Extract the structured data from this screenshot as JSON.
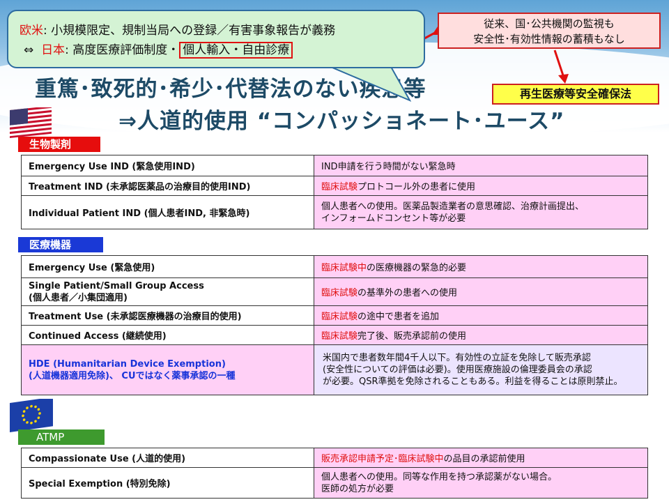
{
  "callout": {
    "line1_prefix": "欧米",
    "line1_text": ": 小規模限定、規制当局への登録／有害事象報告が義務",
    "line2_arrow": "⇔",
    "line2_prefix": "日本",
    "line2_text": ": 高度医療評価制度・",
    "line2_highlight": "個人輸入・自由診療"
  },
  "note": {
    "line1": "従来、国･公共機関の監視も",
    "line2": "安全性･有効性情報の蓄積もなし"
  },
  "law_box": "再生医療等安全確保法",
  "title": {
    "line1": "重篤･致死的･希少･代替法のない疾患等",
    "line2": "⇒人道的使用 “コンパッショネート･ユース”"
  },
  "sections": {
    "us_biologics": "生物製剤",
    "us_devices": "医療機器",
    "eu": "ATMP"
  },
  "biologics_rows": [
    {
      "left": "Emergency Use IND (緊急使用IND)",
      "right": "IND申請を行う時間がない緊急時"
    },
    {
      "left": "Treatment IND  (未承認医薬品の治療目的使用IND)",
      "right_red": "臨床試験",
      "right": "プロトコール外の患者に使用"
    },
    {
      "left": "Individual Patient IND (個人患者IND, 非緊急時)",
      "right_l1": "個人患者への使用。医薬品製造業者の意思確認、治療計画提出、",
      "right_l2": "インフォームドコンセント等が必要"
    }
  ],
  "device_rows": [
    {
      "left": "Emergency Use  (緊急使用)",
      "right_red": "臨床試験中",
      "right": "の医療機器の緊急的必要"
    },
    {
      "left_l1": "Single Patient/Small Group Access",
      "left_l2": "(個人患者／小集団適用)",
      "right_red": "臨床試験",
      "right": "の基準外の患者への使用"
    },
    {
      "left": "Treatment Use (未承認医療機器の治療目的使用)",
      "right_red": "臨床試験",
      "right": "の途中で患者を追加"
    },
    {
      "left": "Continued Access (継続使用)",
      "right_red": "臨床試験",
      "right": "完了後、販売承認前の使用"
    },
    {
      "left_l1": "HDE (Humanitarian Device Exemption)",
      "left_l2": "(人道機器適用免除)、 CUではなく薬事承認の一種",
      "right_l1": "米国内で患者数年間4千人以下。有効性の立証を免除して販売承認",
      "right_l2": "(安全性についての評価は必要)。使用医療施設の倫理委員会の承認",
      "right_l3": "が必要。QSR準拠を免除されることもある。利益を得ることは原則禁止。"
    }
  ],
  "atmp_rows": [
    {
      "left": "Compassionate Use (人道的使用)",
      "right_red": "販売承認申請予定･臨床試験中",
      "right": "の品目の承認前使用"
    },
    {
      "left": "Special Exemption (特別免除)",
      "right_l1": "個人患者への使用。同等な作用を持つ承認薬がない場合。",
      "right_l2": "医師の処方が必要"
    }
  ],
  "colors": {
    "title": "#1d4a66",
    "accent_red": "#e01010",
    "row_pink": "#ffd0f6",
    "callout_green": "#d4f3d4",
    "law_yellow": "#ffff4a"
  },
  "icons": [
    "us-flag-icon",
    "eu-flag-icon",
    "arrow-down-icon"
  ]
}
